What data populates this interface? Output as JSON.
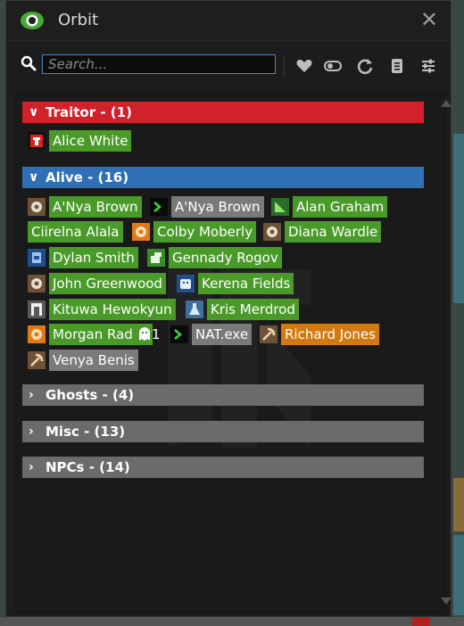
{
  "window": {
    "title": "Orbit"
  },
  "search": {
    "placeholder": "Search..."
  },
  "toolbar": {
    "icons": [
      "heart-icon",
      "toggle-icon",
      "refresh-icon",
      "clipboard-icon",
      "sliders-icon"
    ]
  },
  "colors": {
    "traitor": "#d1212a",
    "alive": "#2f6fb5",
    "collapsed": "#6b6b6b",
    "name_green": "#4a9a2a",
    "name_grey": "#7a7a7a",
    "name_orange": "#d27a12"
  },
  "sections": {
    "traitor": {
      "label": "Traitor - (1)",
      "expanded": true
    },
    "alive": {
      "label": "Alive - (16)",
      "expanded": true
    },
    "ghosts": {
      "label": "Ghosts - (4)",
      "expanded": false
    },
    "misc": {
      "label": "Misc - (13)",
      "expanded": false
    },
    "npcs": {
      "label": "NPCs - (14)",
      "expanded": false
    }
  },
  "traitor_entries": [
    {
      "name": "Alice White",
      "job_icon": "security-icon"
    }
  ],
  "alive_entries": [
    {
      "name": "A'Nya Brown",
      "job_icon": "assistant-icon"
    },
    {
      "name": "A'Nya Brown",
      "job_icon": "terminal-icon"
    },
    {
      "name": "Alan Graham",
      "job_icon": "botany-icon"
    },
    {
      "name": "Ciirelna Alala",
      "job_icon": ""
    },
    {
      "name": "Colby Moberly",
      "job_icon": "assistant-orange-icon"
    },
    {
      "name": "Diana Wardle",
      "job_icon": "assistant-icon"
    },
    {
      "name": "Dylan Smith",
      "job_icon": "engineer-icon"
    },
    {
      "name": "Gennady Rogov",
      "job_icon": "cook-icon"
    },
    {
      "name": "John Greenwood",
      "job_icon": "assistant-icon"
    },
    {
      "name": "Kerena Fields",
      "job_icon": "robot-icon"
    },
    {
      "name": "Kituwa Hewokyun",
      "job_icon": "janitor-icon"
    },
    {
      "name": "Kris Merdrod",
      "job_icon": "scientist-icon"
    },
    {
      "name": "Morgan Rad",
      "job_icon": "assistant-orange-icon",
      "ghost_count": "1"
    },
    {
      "name": "NAT.exe",
      "job_icon": "terminal-icon"
    },
    {
      "name": "Richard Jones",
      "job_icon": "miner-icon"
    },
    {
      "name": "Venya Benis",
      "job_icon": "miner-icon"
    }
  ]
}
